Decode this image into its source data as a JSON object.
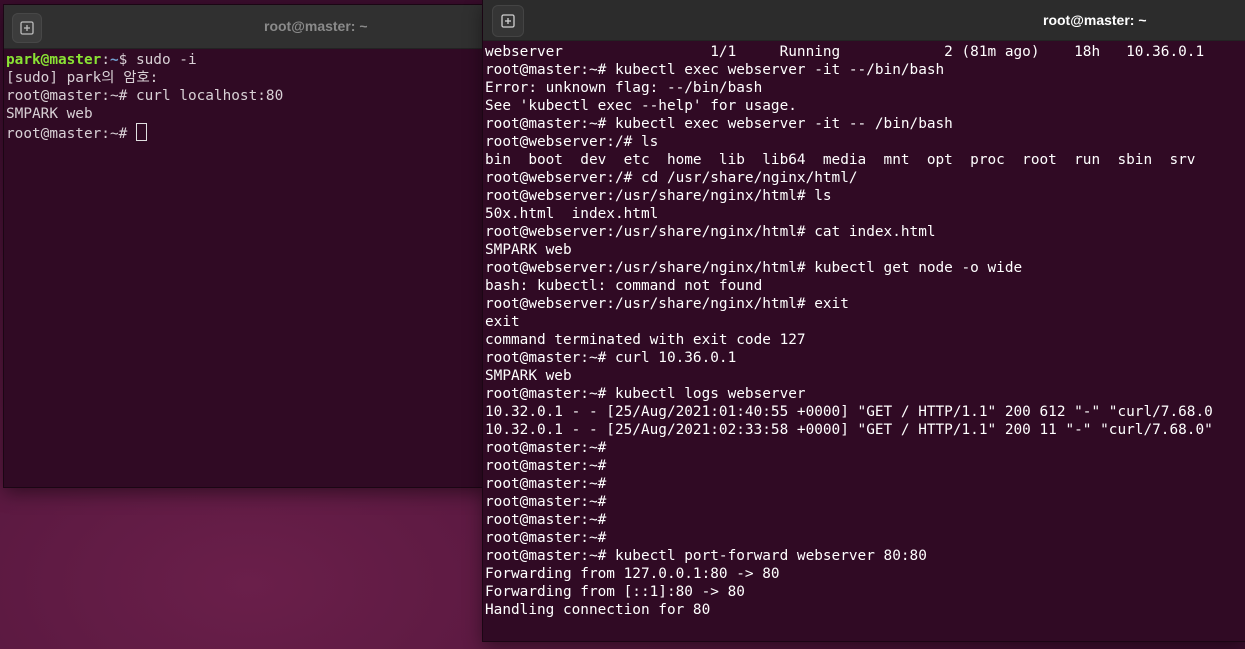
{
  "left_terminal": {
    "title": "root@master: ~",
    "prompt_user": "park@master",
    "prompt_sep": ":",
    "prompt_path": "~",
    "prompt_end": "$ ",
    "first_command": "sudo -i",
    "lines": [
      "[sudo] park의 암호:",
      "root@master:~# curl localhost:80",
      "SMPARK web"
    ],
    "last_prompt": "root@master:~# "
  },
  "right_terminal": {
    "title": "root@master: ~",
    "lines": [
      "webserver                 1/1     Running            2 (81m ago)    18h   10.36.0.1",
      "root@master:~# kubectl exec webserver -it --/bin/bash",
      "Error: unknown flag: --/bin/bash",
      "See 'kubectl exec --help' for usage.",
      "root@master:~# kubectl exec webserver -it -- /bin/bash",
      "root@webserver:/# ls",
      "bin  boot  dev  etc  home  lib  lib64  media  mnt  opt  proc  root  run  sbin  srv",
      "root@webserver:/# cd /usr/share/nginx/html/",
      "root@webserver:/usr/share/nginx/html# ls",
      "50x.html  index.html",
      "root@webserver:/usr/share/nginx/html# cat index.html",
      "SMPARK web",
      "root@webserver:/usr/share/nginx/html# kubectl get node -o wide",
      "bash: kubectl: command not found",
      "root@webserver:/usr/share/nginx/html# exit",
      "exit",
      "command terminated with exit code 127",
      "root@master:~# curl 10.36.0.1",
      "SMPARK web",
      "root@master:~# kubectl logs webserver",
      "10.32.0.1 - - [25/Aug/2021:01:40:55 +0000] \"GET / HTTP/1.1\" 200 612 \"-\" \"curl/7.68.0",
      "10.32.0.1 - - [25/Aug/2021:02:33:58 +0000] \"GET / HTTP/1.1\" 200 11 \"-\" \"curl/7.68.0\"",
      "root@master:~#",
      "root@master:~#",
      "root@master:~#",
      "root@master:~#",
      "root@master:~#",
      "root@master:~#",
      "root@master:~# kubectl port-forward webserver 80:80",
      "Forwarding from 127.0.0.1:80 -> 80",
      "Forwarding from [::1]:80 -> 80",
      "Handling connection for 80"
    ]
  },
  "icons": {
    "new_tab": "new-tab-icon"
  },
  "colors": {
    "terminal_bg": "#300a24",
    "prompt_user": "#8ae234",
    "prompt_path": "#729fcf"
  }
}
